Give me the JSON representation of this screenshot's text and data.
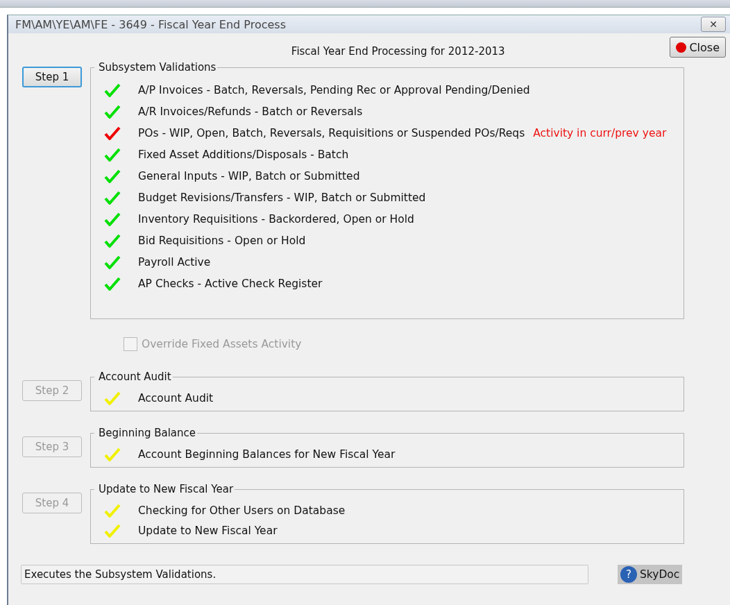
{
  "window": {
    "title": "FM\\AM\\YE\\AM\\FE - 3649 - Fiscal Year End Process",
    "close_glyph": "✕"
  },
  "heading": "Fiscal Year End Processing for 2012-2013",
  "close_button": {
    "label": "Close"
  },
  "steps": [
    {
      "button": "Step 1",
      "disabled": false,
      "selected": true,
      "group": "Subsystem Validations",
      "items": [
        {
          "label": "A/P Invoices - Batch, Reversals, Pending Rec or Approval Pending/Denied",
          "color": "#00e000"
        },
        {
          "label": "A/R Invoices/Refunds - Batch or Reversals",
          "color": "#00e000"
        },
        {
          "label": "POs - WIP, Open, Batch, Reversals, Requisitions or Suspended POs/Reqs",
          "color": "#ee0000",
          "message": "Activity in curr/prev year"
        },
        {
          "label": "Fixed Asset Additions/Disposals - Batch",
          "color": "#00e000"
        },
        {
          "label": "General Inputs - WIP, Batch or Submitted",
          "color": "#00e000"
        },
        {
          "label": "Budget Revisions/Transfers - WIP, Batch or Submitted",
          "color": "#00e000"
        },
        {
          "label": "Inventory Requisitions - Backordered, Open or Hold",
          "color": "#00e000"
        },
        {
          "label": "Bid Requisitions - Open or Hold",
          "color": "#00e000"
        },
        {
          "label": "Payroll Active",
          "color": "#00e000"
        },
        {
          "label": "AP Checks - Active Check Register",
          "color": "#00e000"
        }
      ],
      "option": {
        "label": "Override Fixed Assets Activity",
        "checked": false,
        "disabled": true
      }
    },
    {
      "button": "Step 2",
      "disabled": true,
      "selected": false,
      "group": "Account Audit",
      "items": [
        {
          "label": "Account Audit",
          "color": "#f0f000"
        }
      ]
    },
    {
      "button": "Step 3",
      "disabled": true,
      "selected": false,
      "group": "Beginning Balance",
      "items": [
        {
          "label": "Account Beginning Balances for New Fiscal Year",
          "color": "#f0f000"
        }
      ]
    },
    {
      "button": "Step 4",
      "disabled": true,
      "selected": false,
      "group": "Update to New Fiscal Year",
      "items": [
        {
          "label": "Checking for Other Users on Database",
          "color": "#f0f000"
        },
        {
          "label": "Update to New Fiscal Year",
          "color": "#f0f000"
        }
      ]
    }
  ],
  "status_bar": {
    "text": "Executes the Subsystem Validations.",
    "help_button": {
      "icon_glyph": "?",
      "label": "SkyDoc"
    }
  }
}
